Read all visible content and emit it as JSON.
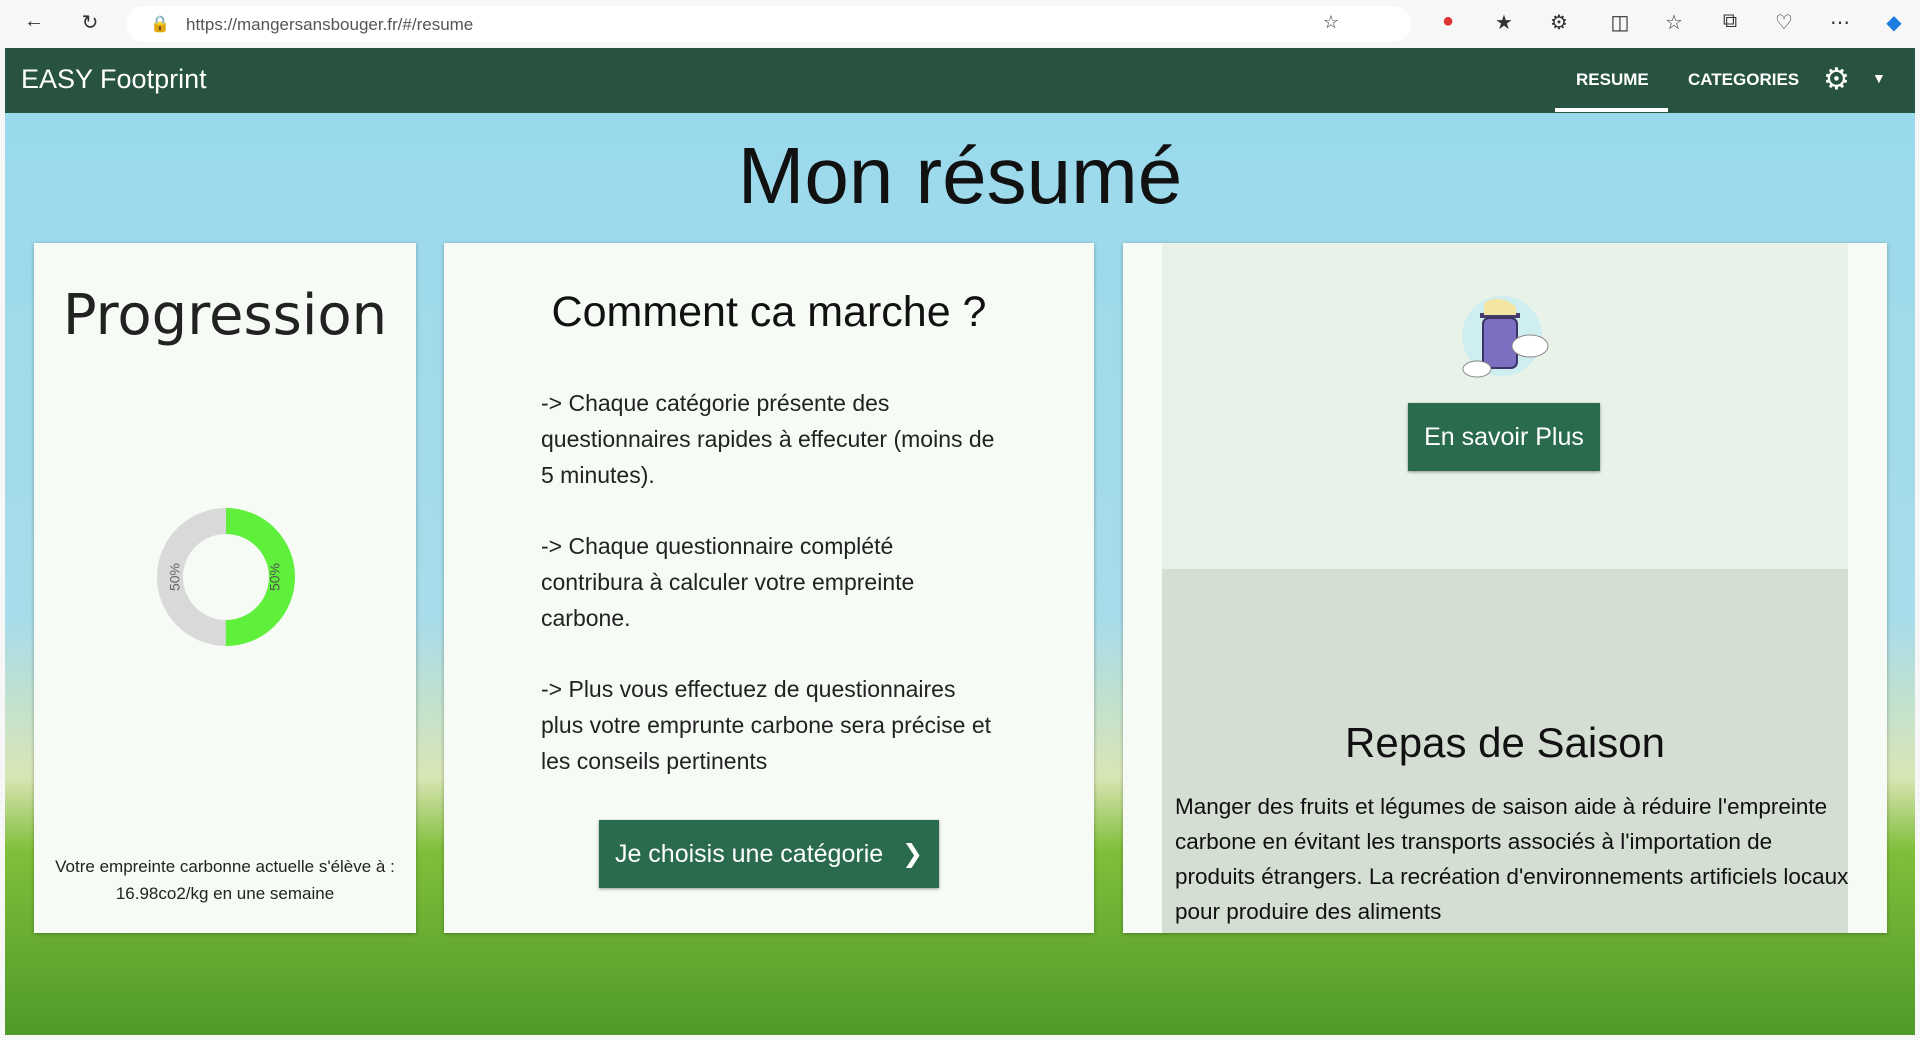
{
  "browser": {
    "url": "https://mangersansbouger.fr/#/resume"
  },
  "appbar": {
    "brand": "EASY Footprint",
    "nav": [
      {
        "label": "RESUME",
        "active": true
      },
      {
        "label": "CATEGORIES",
        "active": false
      }
    ]
  },
  "page": {
    "title": "Mon résumé"
  },
  "progression": {
    "title": "Progression",
    "donut": {
      "completed_percent": 50,
      "remaining_percent": 50,
      "completed_label": "50%",
      "remaining_label": "50%",
      "colors": {
        "completed": "#5ef03a",
        "remaining": "#d9d9d9"
      }
    },
    "text_line1": "Votre empreinte carbonne actuelle s'élève à :",
    "text_line2": "16.98co2/kg en une semaine"
  },
  "how": {
    "title": "Comment ca marche ?",
    "paragraphs": [
      "-> Chaque catégorie présente des questionnaires rapides à effecuter (moins de 5 minutes).",
      "-> Chaque questionnaire complété contribura à calculer votre empreinte carbone.",
      "-> Plus vous effectuez de questionnaires plus votre emprunte carbone sera précise et les conseils pertinents"
    ],
    "button": "Je choisis une catégorie"
  },
  "tips": {
    "button": "En savoir Plus",
    "title": "Repas de Saison",
    "text": "Manger des fruits et légumes de saison aide à réduire l'empreinte carbone en évitant les transports associés à l'importation de produits étrangers. La recréation d'environnements artificiels locaux pour produire des aliments"
  },
  "colors": {
    "appbar": "#285340",
    "button": "#2a6b4d",
    "sky": "#9ad9ec"
  }
}
